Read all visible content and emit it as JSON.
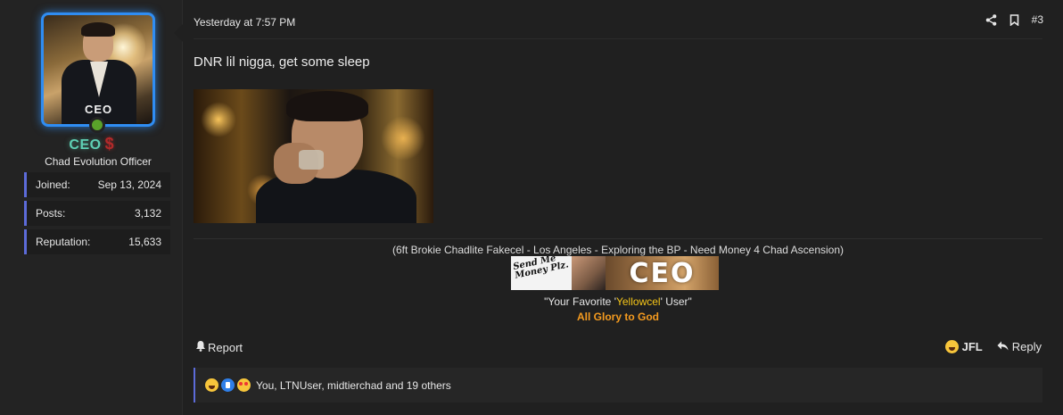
{
  "user": {
    "avatar_text": "CEO",
    "username": "CEO",
    "badge_symbol": "$",
    "title": "Chad Evolution Officer",
    "stats": [
      {
        "label": "Joined:",
        "value": "Sep 13, 2024"
      },
      {
        "label": "Posts:",
        "value": "3,132"
      },
      {
        "label": "Reputation:",
        "value": "15,633"
      }
    ]
  },
  "post": {
    "date": "Yesterday at 7:57 PM",
    "number": "#3",
    "text": "DNR lil nigga, get some sleep"
  },
  "signature": {
    "line1": "(6ft Brokie Chadlite Fakecel - Los Angeles - Exploring the BP - Need Money 4 Chad Ascension)",
    "banner_handwriting": "Send Me Money Plz.",
    "banner_text": "CEO",
    "quote_prefix": "\"Your Favorite '",
    "quote_highlight": "Yellowcel",
    "quote_suffix": "' User\"",
    "glory": "All Glory to God"
  },
  "actions": {
    "report": "Report",
    "jfl": "JFL",
    "reply": "Reply"
  },
  "reactions": {
    "icons": [
      "laughing-emoji",
      "like-emoji",
      "heart-eyes-emoji"
    ],
    "text": "You, LTNUser, midtierchad and 19 others"
  },
  "colors": {
    "accent": "#5c6bd9",
    "username": "#5fd0b5",
    "badge": "#b22a2a",
    "online": "#5aa22a",
    "highlight": "#f5c518",
    "glory": "#f59b1f"
  }
}
